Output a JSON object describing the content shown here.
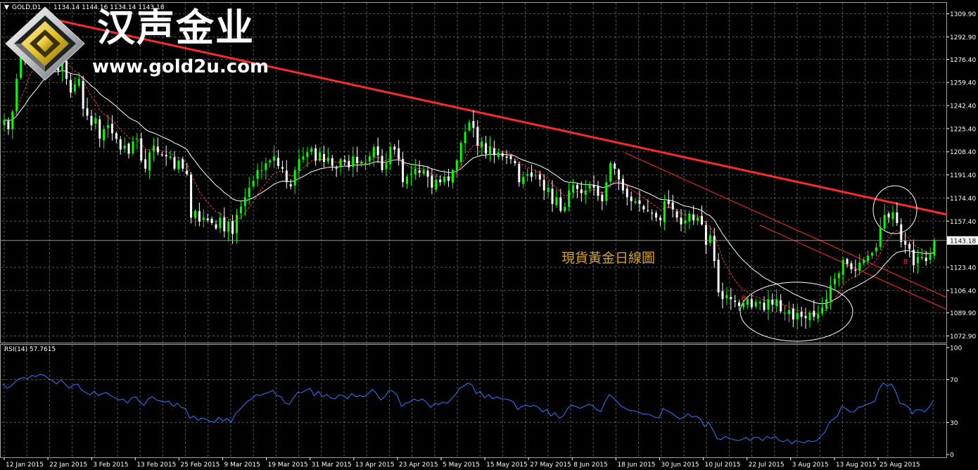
{
  "header": {
    "symbol_label": "GOLD,D1",
    "ohlc": "1134.14 1144.16 1134.14 1143.18",
    "rsi_label": "RSI(14) 57.7615"
  },
  "branding": {
    "name_cn": "汉声金业",
    "url": "www.gold2u.com"
  },
  "annotation": {
    "caption": "現貨黃金日線圖"
  },
  "colors": {
    "background": "#000000",
    "grid": "#9aa59a",
    "bull_candle": "#00ff00",
    "bear_candle": "#ffffff",
    "ma_slow": "#ffffff",
    "ma_fast": "#ff3b30",
    "trendline": "#ff2a2a",
    "channel": "#ff2a2a",
    "rsi_line": "#2f7bff",
    "caption": "#d7a323"
  },
  "chart_data": [
    {
      "type": "candlestick",
      "symbol": "GOLD",
      "timeframe": "D1",
      "ylim": [
        1068.0,
        1318.0
      ],
      "y_ticks": [
        "1309.90",
        "1292.90",
        "1276.40",
        "1259.40",
        "1242.40",
        "1225.40",
        "1208.40",
        "1191.40",
        "1174.40",
        "1157.40",
        "1143.18",
        "1123.40",
        "1106.40",
        "1089.90",
        "1072.90"
      ],
      "x_ticks": [
        "12 Jan 2015",
        "22 Jan 2015",
        "3 Feb 2015",
        "13 Feb 2015",
        "25 Feb 2015",
        "9 Mar 2015",
        "19 Mar 2015",
        "31 Mar 2015",
        "13 Apr 2015",
        "23 Apr 2015",
        "5 May 2015",
        "15 May 2015",
        "27 May 2015",
        "8 Jun 2015",
        "18 Jun 2015",
        "30 Jun 2015",
        "10 Jul 2015",
        "22 Jul 2015",
        "3 Aug 2015",
        "13 Aug 2015",
        "25 Aug 2015"
      ],
      "current_price": 1143.18,
      "close_series": [
        1232,
        1225,
        1238,
        1262,
        1280,
        1278,
        1295,
        1288,
        1290,
        1298,
        1301,
        1287,
        1283,
        1268,
        1276,
        1262,
        1252,
        1258,
        1262,
        1240,
        1235,
        1228,
        1233,
        1218,
        1225,
        1228,
        1222,
        1218,
        1210,
        1213,
        1207,
        1216,
        1218,
        1202,
        1196,
        1208,
        1213,
        1208,
        1206,
        1205,
        1205,
        1196,
        1202,
        1196,
        1192,
        1160,
        1165,
        1157,
        1160,
        1158,
        1156,
        1152,
        1160,
        1150,
        1157,
        1148,
        1162,
        1168,
        1175,
        1182,
        1187,
        1195,
        1195,
        1200,
        1202,
        1205,
        1198,
        1196,
        1186,
        1183,
        1195,
        1203,
        1205,
        1208,
        1211,
        1202,
        1208,
        1201,
        1204,
        1198,
        1196,
        1203,
        1201,
        1197,
        1205,
        1200,
        1201,
        1200,
        1205,
        1212,
        1206,
        1195,
        1200,
        1212,
        1210,
        1203,
        1186,
        1190,
        1192,
        1196,
        1193,
        1195,
        1190,
        1182,
        1188,
        1186,
        1190,
        1187,
        1195,
        1202,
        1215,
        1223,
        1230,
        1226,
        1213,
        1216,
        1207,
        1212,
        1206,
        1208,
        1205,
        1204,
        1203,
        1200,
        1186,
        1190,
        1192,
        1190,
        1191,
        1188,
        1180,
        1182,
        1170,
        1175,
        1165,
        1168,
        1180,
        1184,
        1181,
        1178,
        1180,
        1184,
        1182,
        1176,
        1172,
        1186,
        1200,
        1196,
        1188,
        1180,
        1175,
        1172,
        1172,
        1170,
        1166,
        1165,
        1163,
        1160,
        1158,
        1172,
        1170,
        1166,
        1160,
        1155,
        1158,
        1163,
        1158,
        1160,
        1155,
        1140,
        1147,
        1128,
        1105,
        1100,
        1103,
        1100,
        1098,
        1095,
        1097,
        1100,
        1094,
        1098,
        1098,
        1092,
        1100,
        1096,
        1100,
        1091,
        1090,
        1092,
        1085,
        1090,
        1087,
        1086,
        1090,
        1087,
        1089,
        1094,
        1100,
        1110,
        1115,
        1119,
        1129,
        1126,
        1122,
        1121,
        1127,
        1129,
        1132,
        1134,
        1138,
        1153,
        1162,
        1160,
        1164,
        1156,
        1142,
        1140,
        1137,
        1125,
        1131,
        1131,
        1128,
        1133,
        1143.18
      ],
      "events": [
        {
          "label": "8",
          "price": 1099,
          "bar": 178
        },
        {
          "label": "8",
          "price": 1126,
          "bar": 217
        }
      ]
    },
    {
      "type": "line",
      "indicator": "RSI",
      "period": 14,
      "current_value": 57.7615,
      "ylim": [
        0,
        100
      ],
      "y_ticks": [
        100,
        70,
        30,
        0
      ],
      "values": [
        66,
        62,
        64,
        68,
        71,
        72,
        71,
        74,
        73,
        75,
        74,
        71,
        69,
        66,
        70,
        66,
        62,
        65,
        66,
        60,
        58,
        56,
        59,
        55,
        57,
        58,
        55,
        53,
        51,
        52,
        48,
        53,
        54,
        49,
        46,
        52,
        54,
        51,
        50,
        49,
        50,
        45,
        48,
        44,
        43,
        34,
        36,
        32,
        34,
        33,
        31,
        30,
        35,
        31,
        34,
        30,
        38,
        42,
        46,
        50,
        52,
        56,
        55,
        57,
        58,
        60,
        55,
        54,
        48,
        47,
        53,
        58,
        58,
        60,
        62,
        55,
        59,
        54,
        56,
        53,
        52,
        56,
        55,
        52,
        57,
        54,
        55,
        54,
        57,
        61,
        57,
        51,
        54,
        60,
        59,
        55,
        45,
        48,
        49,
        52,
        50,
        52,
        49,
        44,
        48,
        47,
        49,
        48,
        52,
        56,
        62,
        64,
        67,
        65,
        57,
        59,
        53,
        56,
        52,
        54,
        52,
        52,
        51,
        49,
        42,
        45,
        46,
        45,
        46,
        44,
        40,
        42,
        36,
        39,
        34,
        36,
        43,
        46,
        45,
        43,
        45,
        47,
        46,
        42,
        40,
        49,
        56,
        53,
        49,
        45,
        43,
        41,
        41,
        40,
        38,
        38,
        37,
        35,
        34,
        43,
        41,
        39,
        36,
        33,
        35,
        38,
        35,
        36,
        33,
        26,
        30,
        23,
        15,
        14,
        17,
        15,
        14,
        13,
        14,
        16,
        13,
        16,
        16,
        13,
        17,
        15,
        17,
        13,
        12,
        14,
        10,
        13,
        12,
        11,
        13,
        12,
        13,
        17,
        21,
        30,
        33,
        36,
        45,
        43,
        40,
        40,
        44,
        45,
        47,
        48,
        50,
        61,
        67,
        64,
        66,
        59,
        48,
        47,
        45,
        38,
        42,
        42,
        40,
        44,
        50
      ]
    }
  ]
}
